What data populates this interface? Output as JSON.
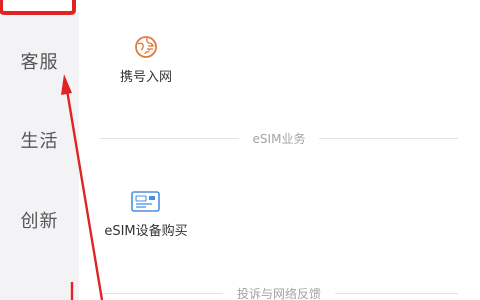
{
  "sidebar": {
    "items": [
      {
        "label": "客服"
      },
      {
        "label": "生活"
      },
      {
        "label": "创新"
      }
    ]
  },
  "main": {
    "tiles": [
      {
        "label": "携号入网",
        "icon": "globe-transfer-icon"
      },
      {
        "label": "eSIM设备购买",
        "icon": "esim-card-icon"
      }
    ],
    "sections": [
      {
        "title": "eSIM业务"
      },
      {
        "title": "投诉与网络反馈"
      }
    ]
  },
  "colors": {
    "sidebar_bg": "#f3f3f5",
    "accent_orange": "#e07b39",
    "esim_blue": "#4a90e2",
    "annotation_red": "#e02424"
  }
}
